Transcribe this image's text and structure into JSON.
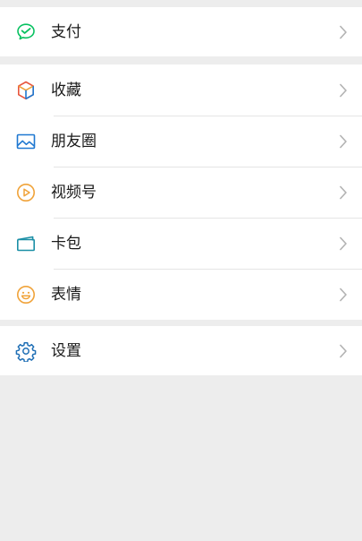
{
  "menu": {
    "pay": {
      "label": "支付",
      "icon": "wechat-pay-icon",
      "color": "#07c160"
    },
    "favorites": {
      "label": "收藏",
      "icon": "cube-icon"
    },
    "moments": {
      "label": "朋友圈",
      "icon": "image-icon",
      "color": "#1f78d1"
    },
    "channels": {
      "label": "视频号",
      "icon": "play-circle-icon",
      "color": "#f0a33a"
    },
    "cards": {
      "label": "卡包",
      "icon": "card-icon",
      "color": "#1b8fa6"
    },
    "stickers": {
      "label": "表情",
      "icon": "smiley-icon",
      "color": "#f0a33a"
    },
    "settings": {
      "label": "设置",
      "icon": "gear-icon",
      "color": "#1f6fb5"
    }
  },
  "colors": {
    "background": "#ededed",
    "chevron": "#b2b2b2",
    "text": "#1a1a1a"
  }
}
